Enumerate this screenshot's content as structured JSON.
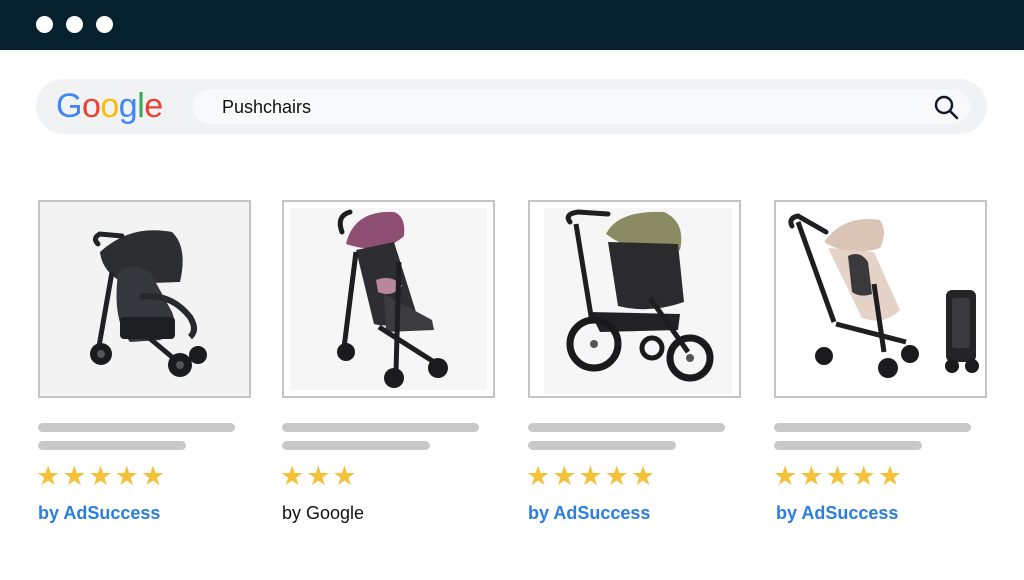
{
  "window": {
    "controls": [
      "dot",
      "dot",
      "dot"
    ]
  },
  "search": {
    "logo_letters": [
      "G",
      "o",
      "o",
      "g",
      "l",
      "e"
    ],
    "logo_colors": [
      "#4285F4",
      "#EA4335",
      "#FBBC05",
      "#4285F4",
      "#34A853",
      "#EA4335"
    ],
    "query": "Pushchairs",
    "icon": "search-icon"
  },
  "products": [
    {
      "image": "black three-wheel pushchair",
      "stars": "★★★★★",
      "rating": 5,
      "by_label": "by AdSuccess",
      "by_color": "#2a7de1"
    },
    {
      "image": "purple compact pushchair",
      "stars": "★★★",
      "rating": 3,
      "by_label": "by Google",
      "by_color": "#111111"
    },
    {
      "image": "green jogging pushchair",
      "stars": "★★★★★",
      "rating": 5,
      "by_label": "by AdSuccess",
      "by_color": "#2a7de1"
    },
    {
      "image": "beige pushchair with folded stroller",
      "stars": "★★★★★",
      "rating": 5,
      "by_label": "by AdSuccess",
      "by_color": "#2a7de1"
    }
  ],
  "colors": {
    "titlebar": "#05212e",
    "star": "#f4c138",
    "placeholder_line": "#c9c9c9"
  }
}
